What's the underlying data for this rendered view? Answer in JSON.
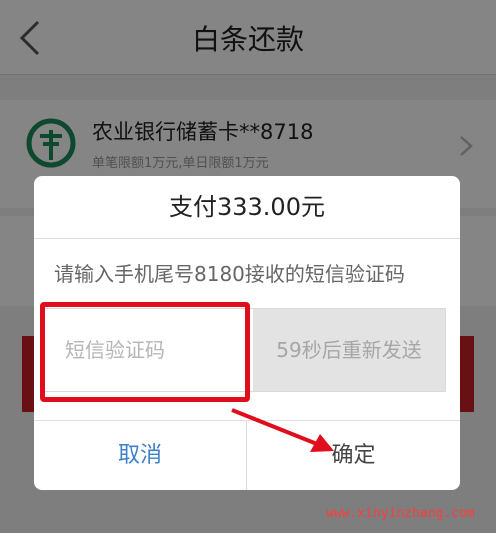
{
  "nav": {
    "title": "白条还款"
  },
  "card": {
    "bank_name": "农业银行储蓄卡**8718",
    "limit_text": "单笔限额1万元,单日限额1万元"
  },
  "dialog": {
    "title": "支付333.00元",
    "message": "请输入手机尾号8180接收的短信验证码",
    "code_placeholder": "短信验证码",
    "code_value": "",
    "resend_label": "59秒后重新发送",
    "cancel_label": "取消",
    "confirm_label": "确定"
  },
  "watermark": "www.xinyinzhang.com",
  "colors": {
    "accent_red": "#e00e1c",
    "cancel_blue": "#3d7fc9",
    "bank_green": "#1a8a5a"
  }
}
